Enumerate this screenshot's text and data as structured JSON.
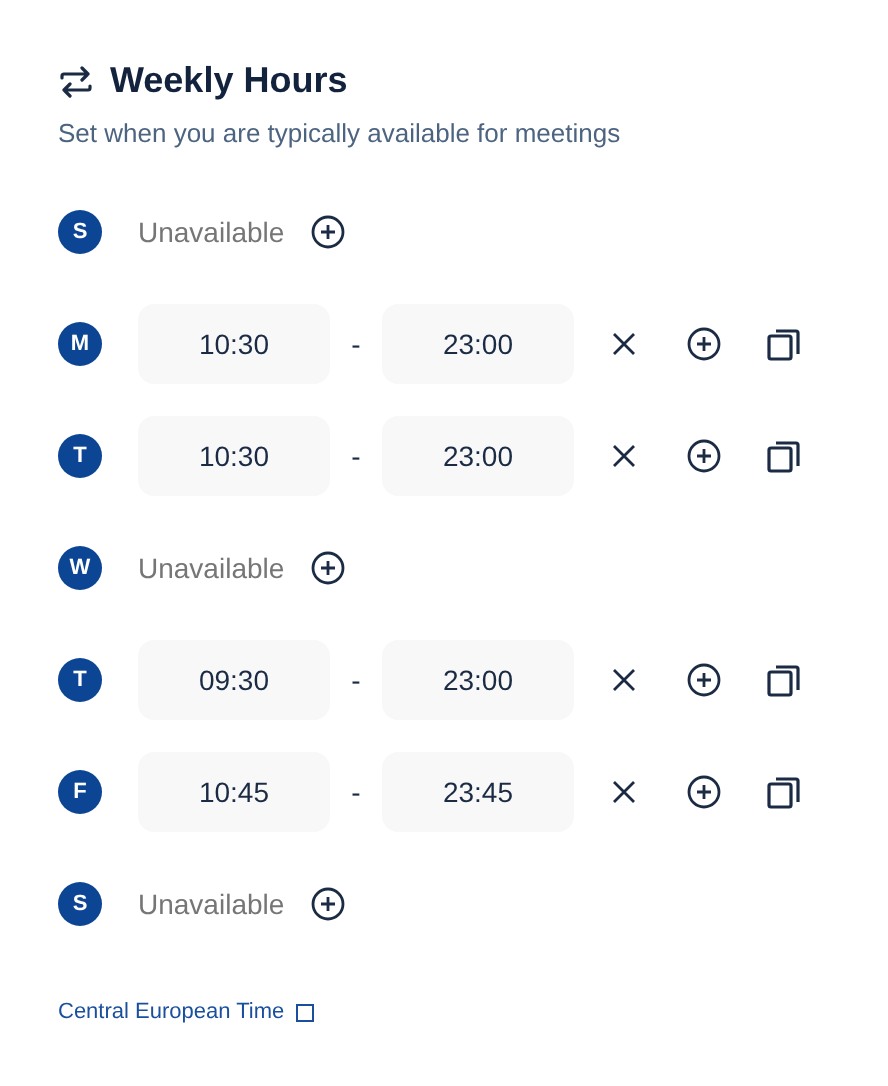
{
  "header": {
    "title": "Weekly Hours",
    "subtitle": "Set when you are typically available for meetings"
  },
  "days": [
    {
      "letter": "S",
      "kind": "unavailable",
      "label": "Unavailable"
    },
    {
      "letter": "M",
      "kind": "hours",
      "start": "10:30",
      "separator": "-",
      "end": "23:00"
    },
    {
      "letter": "T",
      "kind": "hours",
      "start": "10:30",
      "separator": "-",
      "end": "23:00"
    },
    {
      "letter": "W",
      "kind": "unavailable",
      "label": "Unavailable"
    },
    {
      "letter": "T",
      "kind": "hours",
      "start": "09:30",
      "separator": "-",
      "end": "23:00"
    },
    {
      "letter": "F",
      "kind": "hours",
      "start": "10:45",
      "separator": "-",
      "end": "23:45"
    },
    {
      "letter": "S",
      "kind": "unavailable",
      "label": "Unavailable"
    }
  ],
  "timezone": {
    "label": "Central European Time"
  }
}
